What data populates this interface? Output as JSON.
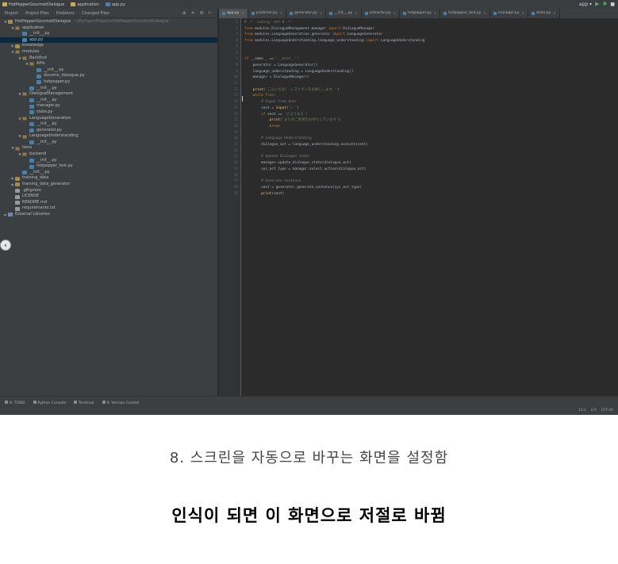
{
  "titlebar": {
    "crumbs": [
      "HotPepperGourmetDialogue",
      "application",
      "app.py"
    ],
    "run_config": "app",
    "run_icon": "play-icon",
    "debug_icon": "bug-icon"
  },
  "project_panel": {
    "tabs": [
      "Project",
      "Project Files",
      "Problems",
      "Changed Files"
    ],
    "tools": "⊕ ≑ ⚙ ⊢",
    "tree": [
      {
        "indent": 0,
        "arrow": "▼",
        "icon": "folder",
        "label": "HotPepperGourmetDialogue",
        "path": "~/PycharmProjects/HotPepperGourmetDialogue"
      },
      {
        "indent": 1,
        "arrow": "▼",
        "icon": "pkg",
        "label": "application"
      },
      {
        "indent": 2,
        "arrow": "",
        "icon": "py",
        "label": "__init__.py"
      },
      {
        "indent": 2,
        "arrow": "",
        "icon": "py",
        "label": "app.py",
        "selected": true
      },
      {
        "indent": 1,
        "arrow": "▶",
        "icon": "folder",
        "label": "knowledge"
      },
      {
        "indent": 1,
        "arrow": "▼",
        "icon": "pkg",
        "label": "modules"
      },
      {
        "indent": 2,
        "arrow": "▼",
        "icon": "pkg",
        "label": "BackEnd"
      },
      {
        "indent": 3,
        "arrow": "▼",
        "icon": "pkg",
        "label": "APIs"
      },
      {
        "indent": 4,
        "arrow": "",
        "icon": "py",
        "label": "__init__.py"
      },
      {
        "indent": 4,
        "arrow": "",
        "icon": "py",
        "label": "docomo_dialogue.py"
      },
      {
        "indent": 4,
        "arrow": "",
        "icon": "py",
        "label": "hotpepper.py"
      },
      {
        "indent": 3,
        "arrow": "",
        "icon": "py",
        "label": "__init__.py"
      },
      {
        "indent": 2,
        "arrow": "▼",
        "icon": "pkg",
        "label": "DialogueManagement"
      },
      {
        "indent": 3,
        "arrow": "",
        "icon": "py",
        "label": "__init__.py"
      },
      {
        "indent": 3,
        "arrow": "",
        "icon": "py",
        "label": "manager.py"
      },
      {
        "indent": 3,
        "arrow": "",
        "icon": "py",
        "label": "state.py"
      },
      {
        "indent": 2,
        "arrow": "▼",
        "icon": "pkg",
        "label": "LanguageGeneration"
      },
      {
        "indent": 3,
        "arrow": "",
        "icon": "py",
        "label": "__init__.py"
      },
      {
        "indent": 3,
        "arrow": "",
        "icon": "py",
        "label": "generator.py"
      },
      {
        "indent": 2,
        "arrow": "▼",
        "icon": "pkg",
        "label": "LanguageUnderstanding"
      },
      {
        "indent": 3,
        "arrow": "",
        "icon": "py",
        "label": "__init__.py"
      },
      {
        "indent": 1,
        "arrow": "▼",
        "icon": "pkg",
        "label": "tests"
      },
      {
        "indent": 2,
        "arrow": "▼",
        "icon": "pkg",
        "label": "backend"
      },
      {
        "indent": 3,
        "arrow": "",
        "icon": "py",
        "label": "__init__.py"
      },
      {
        "indent": 3,
        "arrow": "",
        "icon": "py",
        "label": "hotpepper_test.py"
      },
      {
        "indent": 2,
        "arrow": "",
        "icon": "py",
        "label": "__init__.py"
      },
      {
        "indent": 1,
        "arrow": "▶",
        "icon": "folder",
        "label": "training_data"
      },
      {
        "indent": 1,
        "arrow": "▶",
        "icon": "folder",
        "label": "training_data_generator"
      },
      {
        "indent": 1,
        "arrow": "",
        "icon": "file",
        "label": ".gitignore"
      },
      {
        "indent": 1,
        "arrow": "",
        "icon": "file",
        "label": "LICENSE"
      },
      {
        "indent": 1,
        "arrow": "",
        "icon": "file",
        "label": "README.md"
      },
      {
        "indent": 1,
        "arrow": "",
        "icon": "file",
        "label": "requirements.txt"
      },
      {
        "indent": 0,
        "arrow": "▶",
        "icon": "lib",
        "label": "External Libraries"
      }
    ]
  },
  "editor": {
    "tabs": [
      {
        "label": "app.py",
        "active": true
      },
      {
        "label": "predictor.py"
      },
      {
        "label": "generator.py"
      },
      {
        "label": "__init__.py"
      },
      {
        "label": "extractor.py"
      },
      {
        "label": "hotpepper.py"
      },
      {
        "label": "hotpepper_test.py"
      },
      {
        "label": "manager.py"
      },
      {
        "label": "state.py"
      }
    ],
    "lines": [
      {
        "n": "1",
        "html": "<span class=\"cm\"># -*- coding: utf-8 -*-</span>"
      },
      {
        "n": "2",
        "html": "<span class=\"kw\">from</span> modules.DialogueManagement.manager <span class=\"kw\">import</span> DialogueManager"
      },
      {
        "n": "3",
        "html": "<span class=\"kw\">from</span> modules.LanguageGeneration.generator <span class=\"kw\">import</span> LanguageGenerator"
      },
      {
        "n": "4",
        "html": "<span class=\"kw\">from</span> modules.LanguageUnderstanding.language_understanding <span class=\"kw\">import</span> LanguageUnderstanding"
      },
      {
        "n": "5",
        "html": ""
      },
      {
        "n": "6",
        "html": ""
      },
      {
        "n": "7",
        "html": "<span class=\"kw\">if</span> __name__ == <span class=\"st\">'__main__'</span>:"
      },
      {
        "n": "8",
        "html": "    generator = LanguageGenerator()"
      },
      {
        "n": "9",
        "html": "    language_understanding = LanguageUnderstanding()"
      },
      {
        "n": "10",
        "html": "    manager = DialogueManager()"
      },
      {
        "n": "11",
        "html": ""
      },
      {
        "n": "12",
        "html": "    <span class=\"fn\">print</span>(<span class=\"st\">'こんにちは！ レストランをお探しします。'</span>)"
      },
      {
        "n": "13",
        "html": "    <span class=\"kw\">while True</span>:"
      },
      {
        "n": "14",
        "html": "        <span class=\"cm\"># Input from User</span>"
      },
      {
        "n": "15",
        "html": "        sent = <span class=\"fn\">input</span>(<span class=\"st\">'> '</span>)"
      },
      {
        "n": "16",
        "html": "        <span class=\"kw\">if</span> sent == <span class=\"st\">'さようなら'</span>:"
      },
      {
        "n": "17",
        "html": "            <span class=\"fn\">print</span>(<span class=\"st\">'またのご利用をお待ちしています'</span>)"
      },
      {
        "n": "18",
        "html": "            <span class=\"kw\">break</span>"
      },
      {
        "n": "19",
        "html": ""
      },
      {
        "n": "20",
        "html": "        <span class=\"cm\"># Language Understanding</span>"
      },
      {
        "n": "21",
        "html": "        dialogue_act = language_understanding.execute(sent)"
      },
      {
        "n": "22",
        "html": ""
      },
      {
        "n": "23",
        "html": "        <span class=\"cm\"># Update Dialogue state</span>"
      },
      {
        "n": "24",
        "html": "        manager.update_dialogue_state(dialogue_act)"
      },
      {
        "n": "25",
        "html": "        sys_act_type = manager.select_action(dialogue_act)"
      },
      {
        "n": "26",
        "html": ""
      },
      {
        "n": "27",
        "html": "        <span class=\"cm\"># Generate Sentence</span>"
      },
      {
        "n": "28",
        "html": "        sent = generator.generate_sentence(sys_act_type)"
      },
      {
        "n": "29",
        "html": "        <span class=\"fn\">print</span>(sent)"
      }
    ]
  },
  "bottombar": {
    "toolwindows": [
      "6: TODO",
      "Python Console",
      "Terminal",
      "9: Version Control"
    ],
    "status_position": "14:1",
    "status_encoding": "LF‡",
    "status_charset": "UTF-8‡"
  },
  "captions": {
    "line1": "8. 스크린을 자동으로 바꾸는 화면을 설정함",
    "line2": "인식이 되면 이 화면으로 저절로 바뀜"
  },
  "colors": {
    "ide_background": "#2b2b2b",
    "panel_background": "#3c3f41",
    "selection": "#0d293e"
  }
}
